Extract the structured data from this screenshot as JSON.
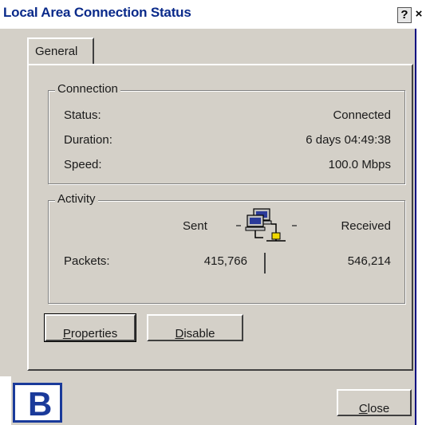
{
  "window": {
    "title": "Local Area Connection Status",
    "help_glyph": "?",
    "close_glyph": "×"
  },
  "tabs": [
    {
      "label": "General",
      "active": true
    }
  ],
  "connection": {
    "group_label": "Connection",
    "rows": [
      {
        "label": "Status:",
        "value": "Connected"
      },
      {
        "label": "Duration:",
        "value": "6 days 04:49:38"
      },
      {
        "label": "Speed:",
        "value": "100.0 Mbps"
      }
    ]
  },
  "activity": {
    "group_label": "Activity",
    "sent_label": "Sent",
    "received_label": "Received",
    "packets_label": "Packets:",
    "packets_sent": "415,766",
    "packets_received": "546,214",
    "icon": "network-computers-icon"
  },
  "buttons": {
    "properties_pre": "",
    "properties_mnemonic": "P",
    "properties_post": "roperties",
    "disable_pre": "",
    "disable_mnemonic": "D",
    "disable_post": "isable",
    "close_pre": "",
    "close_mnemonic": "C",
    "close_post": "lose"
  },
  "badge": {
    "letter": "B"
  },
  "colors": {
    "title_text": "#0a2a8a",
    "dialog_face": "#d4d0c8",
    "badge": "#1a3a9a",
    "plug_yellow": "#f0d800"
  }
}
